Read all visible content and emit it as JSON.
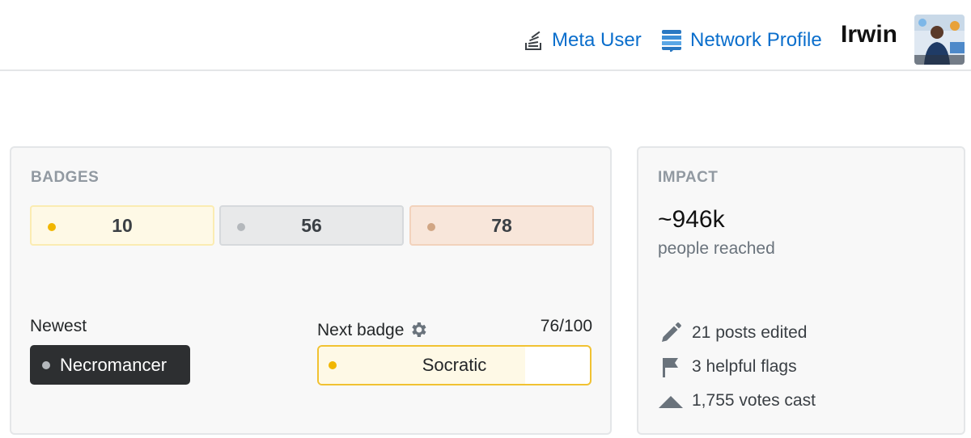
{
  "header": {
    "meta_user_label": "Meta User",
    "network_profile_label": "Network Profile",
    "username": "Irwin",
    "link_color": "#0a6ecc"
  },
  "badges": {
    "title": "BADGES",
    "gold": {
      "count": "10",
      "color": "#f1b600"
    },
    "silver": {
      "count": "56",
      "color": "#b4b8bc"
    },
    "bronze": {
      "count": "78",
      "color": "#d1a684"
    },
    "newest_label": "Newest",
    "newest_badge": "Necromancer",
    "next_label": "Next badge",
    "next_progress_text": "76/100",
    "next_progress_value": 0.76,
    "next_badge": "Socratic"
  },
  "impact": {
    "title": "IMPACT",
    "people_reached": "~946k",
    "people_reached_label": "people reached",
    "posts_edited": "21 posts edited",
    "helpful_flags": "3 helpful flags",
    "votes_cast": "1,755 votes cast",
    "icons": [
      "pencil-icon",
      "flag-icon",
      "upvote-arrow-icon"
    ]
  }
}
